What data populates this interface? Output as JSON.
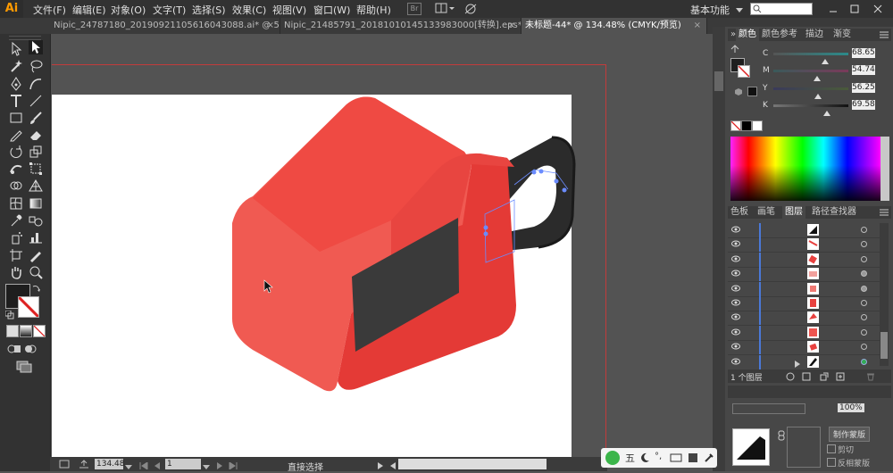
{
  "app": {
    "logo": "Ai",
    "menu": [
      "文件(F)",
      "编辑(E)",
      "对象(O)",
      "文字(T)",
      "选择(S)",
      "效果(C)",
      "视图(V)",
      "窗口(W)",
      "帮助(H)"
    ],
    "workspace": "基本功能",
    "bridge_label": "Br"
  },
  "tabs": [
    {
      "label": "Nipic_24787180_20190921105616043088.ai* @ 50...",
      "close": "×"
    },
    {
      "label": "Nipic_21485791_20181010145133983000[转换].eps*",
      "close": "×"
    },
    {
      "label": "未标题-44* @ 134.48% (CMYK/预览)",
      "close": "×"
    }
  ],
  "color_panel": {
    "tabs": [
      "颜色",
      "颜色参考",
      "描边",
      "渐变"
    ],
    "channels": [
      {
        "name": "C",
        "value": "68.65"
      },
      {
        "name": "M",
        "value": "54.74"
      },
      {
        "name": "Y",
        "value": "56.25"
      },
      {
        "name": "K",
        "value": "69.58"
      }
    ]
  },
  "layers_panel": {
    "tabs": [
      "色板",
      "画笔",
      "图层",
      "路径查找器"
    ],
    "count_label": "1 个图层"
  },
  "bottom_panel": {
    "opacity_value": "100%",
    "make_mask": "制作蒙版",
    "clip_label": "剪切",
    "invert_label": "反相蒙版"
  },
  "status": {
    "zoom": "134.48",
    "page": "1",
    "tool": "直接选择"
  },
  "colors": {
    "red": "#e8413f",
    "dark": "#2a2a2a",
    "screen": "#3c3c3c"
  }
}
